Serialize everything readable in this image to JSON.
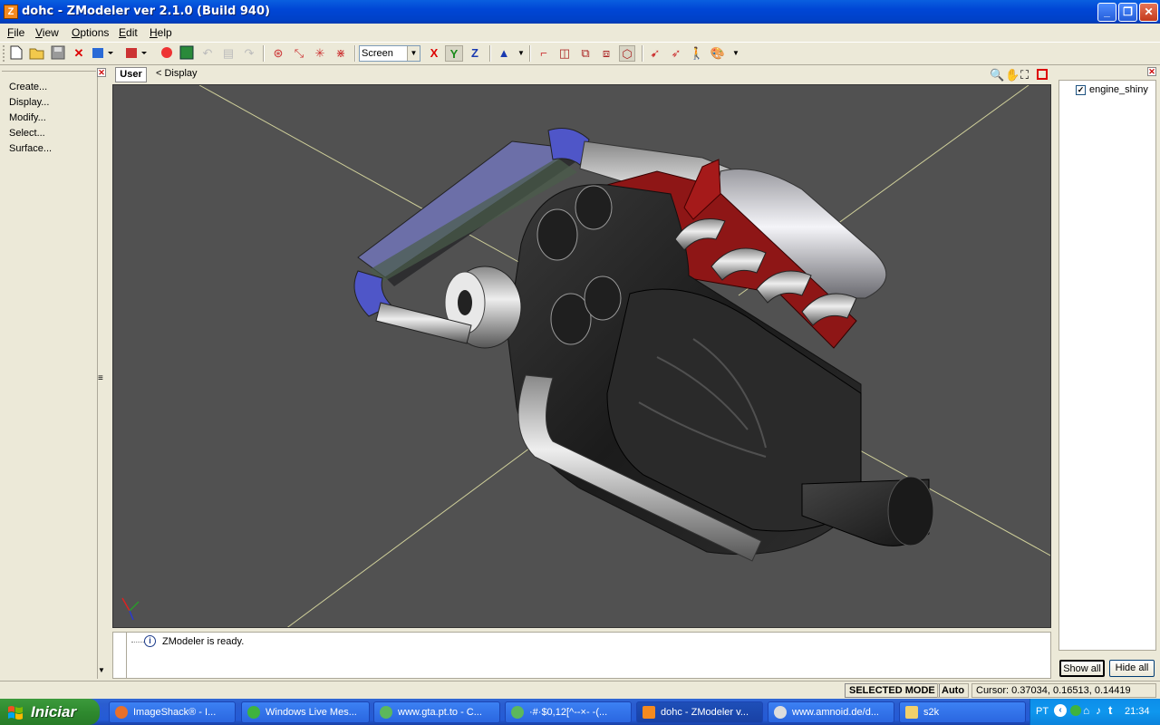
{
  "window": {
    "title": "dohc - ZModeler ver 2.1.0 (Build 940)",
    "app_icon_letter": "Z"
  },
  "menu": [
    {
      "u": "F",
      "rest": "ile"
    },
    {
      "u": "V",
      "rest": "iew"
    },
    {
      "u": "O",
      "rest": "ptions"
    },
    {
      "u": "E",
      "rest": "dit"
    },
    {
      "u": "H",
      "rest": "elp"
    }
  ],
  "toolbar": {
    "view_select": "Screen",
    "axis_x": "X",
    "axis_y": "Y",
    "axis_z": "Z"
  },
  "left_panel": {
    "items": [
      "Create...",
      "Display...",
      "Modify...",
      "Select...",
      "Surface..."
    ]
  },
  "viewport": {
    "view_label": "User",
    "breadcrumb": "<  Display"
  },
  "log": {
    "message": "ZModeler is ready."
  },
  "right_panel": {
    "object_name": "engine_shiny",
    "show_all": "Show all",
    "hide_all": "Hide all"
  },
  "statusbar": {
    "mode": "SELECTED MODE",
    "auto": "Auto",
    "cursor": "Cursor: 0.37034, 0.16513, 0.14419"
  },
  "taskbar": {
    "start": "Iniciar",
    "tasks": [
      {
        "label": "ImageShack® - I...",
        "color": "#e8702a"
      },
      {
        "label": "Windows Live Mes...",
        "color": "#3fb33f"
      },
      {
        "label": "www.gta.pt.to - C...",
        "color": "#5cb85c"
      },
      {
        "label": "·#·$0,12[^--×- -(...",
        "color": "#5cb85c"
      },
      {
        "label": "dohc - ZModeler v...",
        "color": "#f58a1f"
      },
      {
        "label": "www.amnoid.de/d...",
        "color": "#dddddd"
      },
      {
        "label": "s2k",
        "color": "#f2d06b"
      }
    ],
    "lang": "PT",
    "clock": "21:34"
  }
}
